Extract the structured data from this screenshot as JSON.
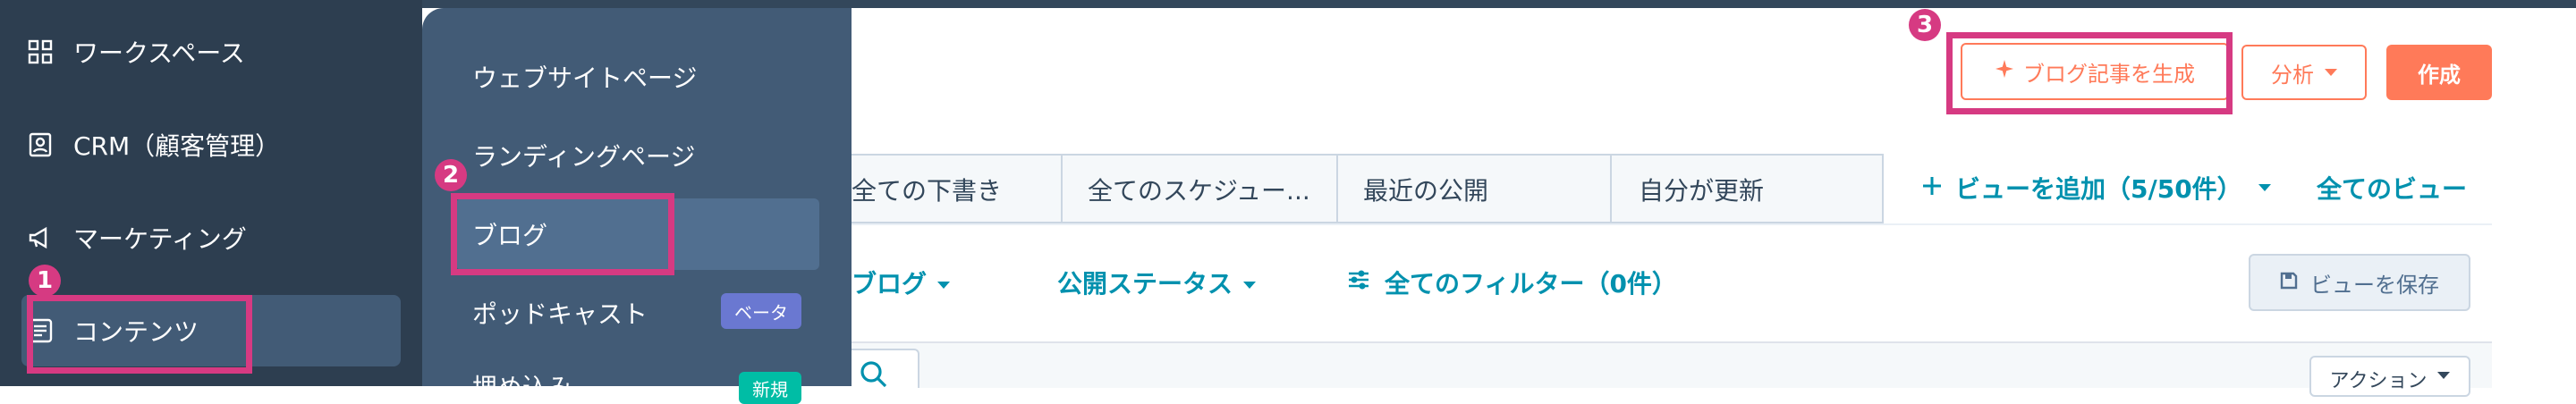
{
  "sidebar": {
    "items": [
      {
        "label": "ワークスペース",
        "icon": "grid-icon"
      },
      {
        "label": "CRM（顧客管理）",
        "icon": "contacts-icon"
      },
      {
        "label": "マーケティング",
        "icon": "megaphone-icon"
      },
      {
        "label": "コンテンツ",
        "icon": "content-icon"
      }
    ]
  },
  "flyout": {
    "items": [
      {
        "label": "ウェブサイトページ"
      },
      {
        "label": "ランディングページ"
      },
      {
        "label": "ブログ"
      },
      {
        "label": "ポッドキャスト",
        "badge": "ベータ"
      },
      {
        "label": "埋め込み",
        "badge": "新規"
      }
    ]
  },
  "annotations": {
    "step1": "1",
    "step2": "2",
    "step3": "3"
  },
  "header": {
    "generate_blog_label": "ブログ記事を生成",
    "analyze_label": "分析",
    "create_label": "作成"
  },
  "views": {
    "tabs": [
      {
        "label": "全ての下書き"
      },
      {
        "label": "全てのスケジュー..."
      },
      {
        "label": "最近の公開"
      },
      {
        "label": "自分が更新"
      }
    ],
    "add_view_label": "ビューを追加（5/50件）",
    "all_views_label": "全てのビュー"
  },
  "filters": {
    "blog_label": "ブログ",
    "status_label": "公開ステータス",
    "all_filters_label": "全てのフィルター（0件）",
    "save_view_label": "ビューを保存"
  },
  "table": {
    "actions_label": "アクション"
  },
  "colors": {
    "sidebar": "#2d3e50",
    "flyout": "#425b76",
    "highlight": "#d63a82",
    "accent_orange": "#ff7a59",
    "teal": "#0091ae"
  }
}
